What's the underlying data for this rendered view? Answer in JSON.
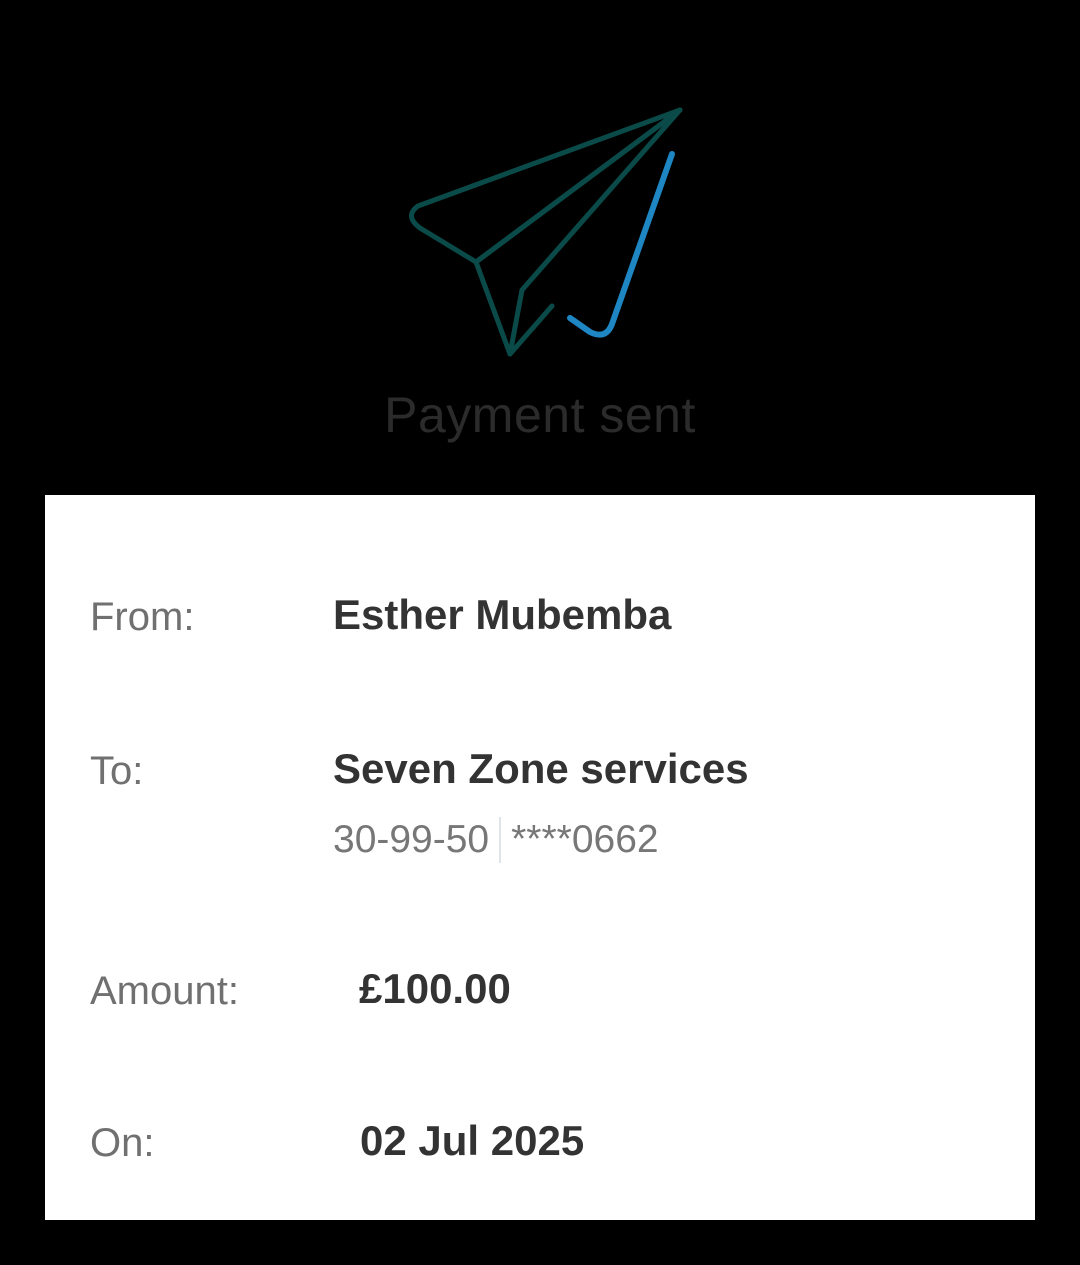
{
  "header": {
    "icon": "paper-plane-icon",
    "title": "Payment sent",
    "colors": {
      "plane": "#0a4a48",
      "trail": "#1f86c4"
    }
  },
  "details": {
    "from": {
      "label": "From:",
      "value": "Esther Mubemba"
    },
    "to": {
      "label": "To:",
      "value": "Seven Zone services",
      "sort_code": "30-99-50",
      "account": "****0662"
    },
    "amount": {
      "label": "Amount:",
      "value": "£100.00"
    },
    "date": {
      "label": "On:",
      "value": "02 Jul 2025"
    }
  }
}
